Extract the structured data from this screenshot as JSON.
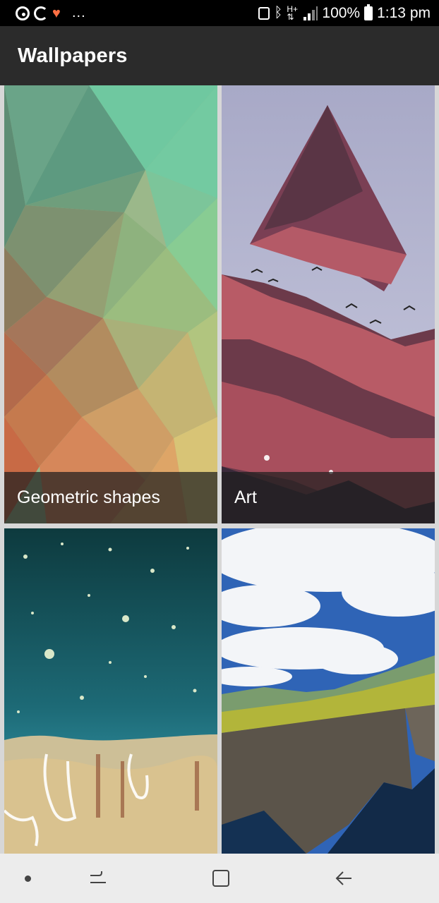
{
  "status_bar": {
    "left_icons": [
      "data-saver-icon",
      "sync-arc-icon",
      "health-heart-icon"
    ],
    "more": "...",
    "battery_percent": "100%",
    "time": "1:13 pm",
    "right_icons": [
      "nfc-icon",
      "bluetooth-icon",
      "hplus-signal-icon",
      "cell-signal-icon",
      "battery-icon"
    ]
  },
  "app_bar": {
    "title": "Wallpapers"
  },
  "tiles": [
    {
      "label": "Geometric shapes",
      "image": "low-poly gradient pattern"
    },
    {
      "label": "Art",
      "image": "mountain collage triangle with birds"
    },
    {
      "label": "",
      "image": "aerial coastline with stars"
    },
    {
      "label": "",
      "image": "sea cliffs under blue sky"
    }
  ],
  "nav_bar": {
    "buttons": [
      "dot-indicator",
      "recents-button",
      "home-button",
      "back-button"
    ]
  },
  "colors": {
    "status_bar_bg": "#000000",
    "app_bar_bg": "#2b2b2b",
    "nav_bar_bg": "#ececec",
    "label_overlay": "#1e1e1e"
  }
}
